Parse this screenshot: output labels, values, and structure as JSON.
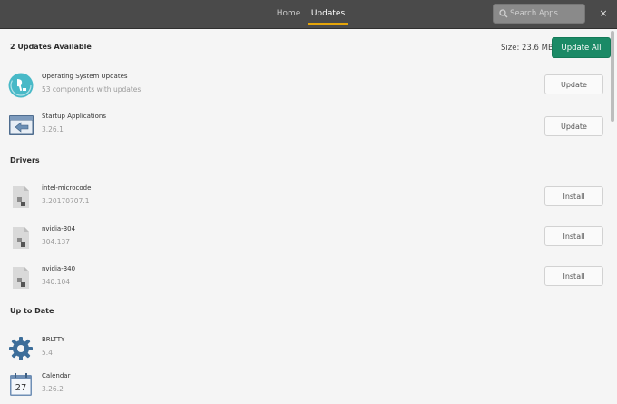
{
  "header": {
    "tabs": [
      {
        "label": "Home",
        "active": false
      },
      {
        "label": "Updates",
        "active": true
      }
    ],
    "search": {
      "placeholder": "Search Apps",
      "value": ""
    },
    "close_label": "×"
  },
  "summary": {
    "title": "2 Updates Available",
    "size_label": "Size: 23.6 MB",
    "update_all_label": "Update All"
  },
  "updates": [
    {
      "name": "Operating System Updates",
      "sub": "53 components with updates",
      "button": "Update",
      "icon": "pop-os-logo-icon"
    },
    {
      "name": "Startup Applications",
      "sub": "3.26.1",
      "button": "Update",
      "icon": "startup-applications-icon"
    }
  ],
  "drivers": {
    "title": "Drivers",
    "items": [
      {
        "name": "intel-microcode",
        "sub": "3.20170707.1",
        "button": "Install",
        "icon": "package-icon"
      },
      {
        "name": "nvidia-304",
        "sub": "304.137",
        "button": "Install",
        "icon": "package-icon"
      },
      {
        "name": "nvidia-340",
        "sub": "340.104",
        "button": "Install",
        "icon": "package-icon"
      }
    ]
  },
  "up_to_date": {
    "title": "Up to Date",
    "items": [
      {
        "name": "BRLTTY",
        "sub": "5.4",
        "icon": "gear-icon"
      },
      {
        "name": "Calendar",
        "sub": "3.26.2",
        "icon": "calendar-icon",
        "icon_text": "27"
      }
    ]
  },
  "colors": {
    "accent": "#1b8a66",
    "tab_underline": "#e5a50a",
    "header_bg": "#4a4a4a"
  }
}
